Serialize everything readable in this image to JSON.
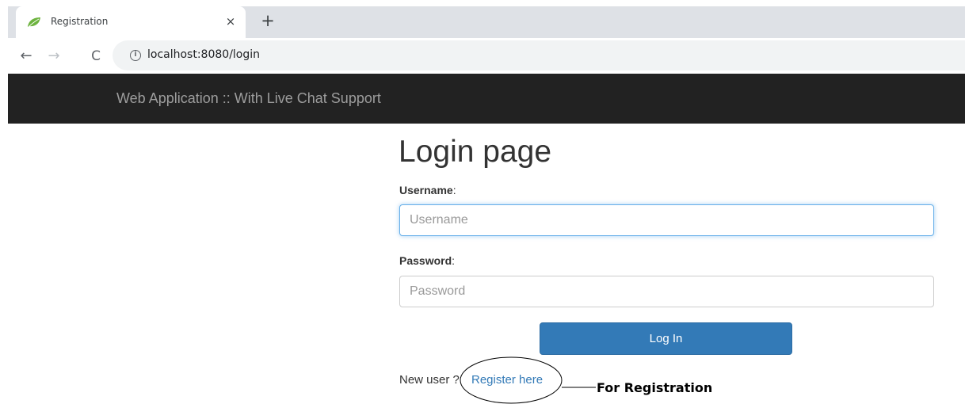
{
  "browser": {
    "tab_title": "Registration",
    "tab_close": "×",
    "new_tab": "+",
    "url": "localhost:8080/login",
    "nav": {
      "back": "←",
      "forward": "→",
      "reload": "C",
      "info": "i"
    },
    "favicon_icon": "spring-leaf-icon"
  },
  "navbar": {
    "brand": "Web Application :: With Live Chat Support"
  },
  "login": {
    "title": "Login page",
    "username_label": "Username",
    "username_colon": ":",
    "username_placeholder": "Username",
    "username_value": "",
    "password_label": "Password",
    "password_colon": ":",
    "password_placeholder": "Password",
    "password_value": "",
    "submit_label": "Log In",
    "new_user_text": "New user ?",
    "register_link": "Register here"
  },
  "annotation": {
    "label": "For Registration"
  },
  "colors": {
    "navbar_bg": "#222222",
    "primary": "#337ab7",
    "favicon": "#6db33f"
  }
}
